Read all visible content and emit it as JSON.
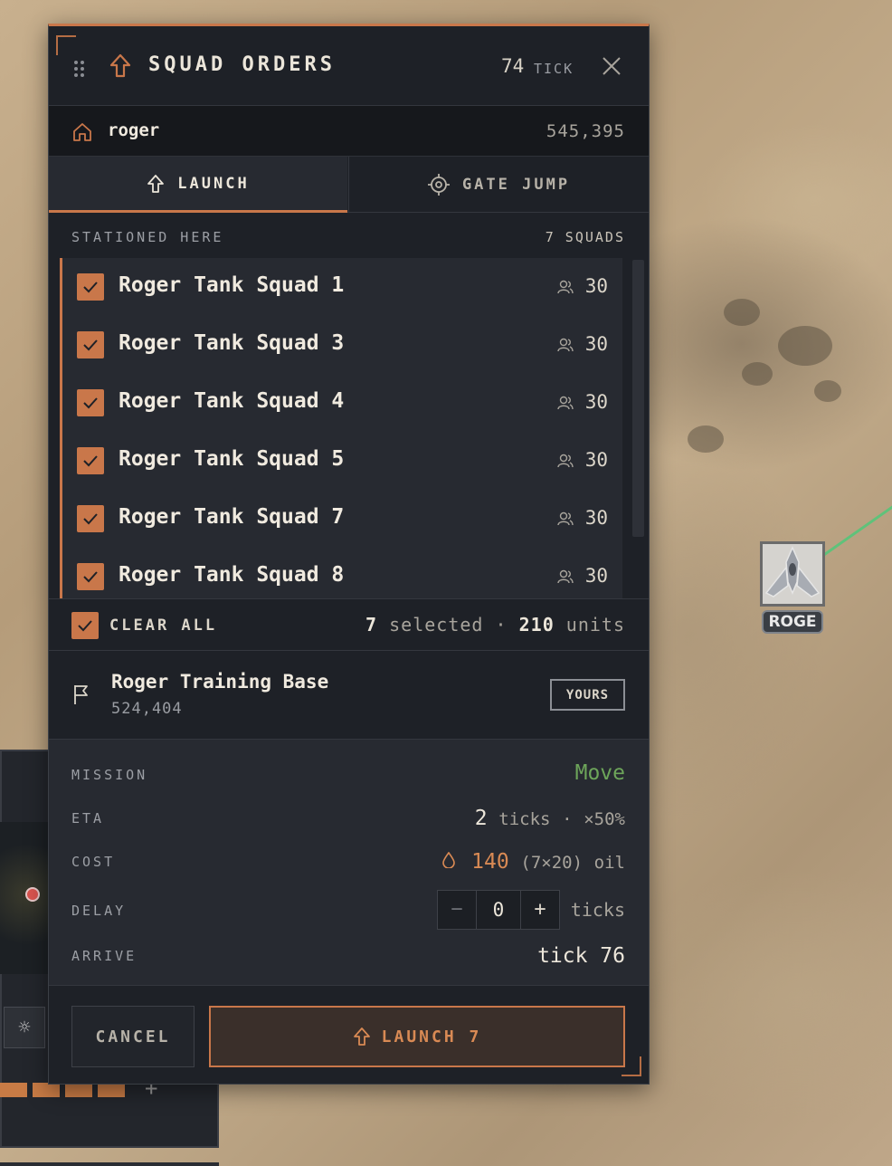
{
  "map": {
    "marker_label": "ROGE",
    "route_color": "#5fc27a"
  },
  "colors": {
    "accent": "#c9774a",
    "mission_green": "#6da55a",
    "panel_bg": "#1e2127"
  },
  "dialog": {
    "title": "SQUAD ORDERS",
    "tick_value": "74",
    "tick_label": "TICK",
    "header_icon": "arrow-up-icon",
    "close_icon": "close-icon"
  },
  "origin": {
    "name": "roger",
    "coords": "545,395",
    "icon": "home-icon"
  },
  "tabs": [
    {
      "label": "LAUNCH",
      "icon": "arrow-up-icon",
      "active": true
    },
    {
      "label": "GATE JUMP",
      "icon": "target-icon",
      "active": false
    }
  ],
  "stationed": {
    "label": "STATIONED HERE",
    "count": "7 SQUADS"
  },
  "squads": [
    {
      "name": "Roger Tank Squad 1",
      "size": "30",
      "checked": true
    },
    {
      "name": "Roger Tank Squad 3",
      "size": "30",
      "checked": true
    },
    {
      "name": "Roger Tank Squad 4",
      "size": "30",
      "checked": true
    },
    {
      "name": "Roger Tank Squad 5",
      "size": "30",
      "checked": true
    },
    {
      "name": "Roger Tank Squad 7",
      "size": "30",
      "checked": true
    },
    {
      "name": "Roger Tank Squad 8",
      "size": "30",
      "checked": true
    }
  ],
  "summary": {
    "clear_label": "CLEAR ALL",
    "selected_count": "7",
    "selected_label": "selected",
    "separator": "·",
    "units_count": "210",
    "units_label": "units"
  },
  "target": {
    "name": "Roger Training Base",
    "coords": "524,404",
    "badge": "YOURS",
    "icon": "flag-icon"
  },
  "details": {
    "mission_label": "MISSION",
    "mission_value": "Move",
    "eta_label": "ETA",
    "eta_value": "2",
    "eta_unit": "ticks",
    "eta_separator": "·",
    "eta_modifier": "×50%",
    "cost_label": "COST",
    "cost_icon": "oil-drop-icon",
    "cost_value": "140",
    "cost_breakdown": "(7×20)",
    "cost_unit": "oil",
    "delay_label": "DELAY",
    "delay_minus": "−",
    "delay_value": "0",
    "delay_plus": "+",
    "delay_unit": "ticks",
    "arrive_label": "ARRIVE",
    "arrive_value": "tick 76"
  },
  "footer": {
    "cancel_label": "CANCEL",
    "launch_label": "LAUNCH 7",
    "launch_icon": "arrow-up-icon"
  },
  "background_panel": {
    "gear_icon": "gear-icon",
    "add_label": "+"
  }
}
